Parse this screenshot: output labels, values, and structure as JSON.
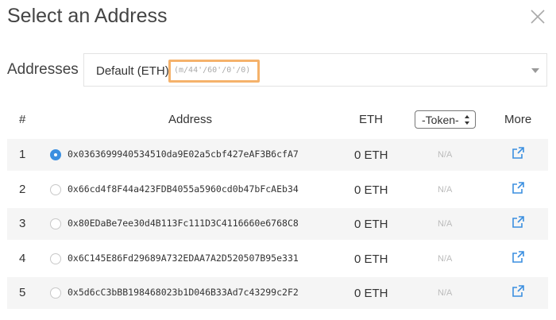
{
  "dialog": {
    "title": "Select an Address"
  },
  "addresses": {
    "label": "Addresses",
    "selected": "Default (ETH)",
    "path": "(m/44'/60'/0'/0)"
  },
  "table": {
    "headers": {
      "num": "#",
      "address": "Address",
      "eth": "ETH",
      "token": "-Token-",
      "more": "More"
    },
    "rows": [
      {
        "num": "1",
        "address": "0x0363699940534510da9E02a5cbf427eAF3B6cfA7",
        "eth": "0 ETH",
        "token": "N/A",
        "selected": true
      },
      {
        "num": "2",
        "address": "0x66cd4f8F44a423FDB4055a5960cd0b47bFcAEb34",
        "eth": "0 ETH",
        "token": "N/A",
        "selected": false
      },
      {
        "num": "3",
        "address": "0x80EDaBe7ee30d4B113Fc111D3C4116660e6768C8",
        "eth": "0 ETH",
        "token": "N/A",
        "selected": false
      },
      {
        "num": "4",
        "address": "0x6C145E86Fd29689A732EDAA7A2D520507B95e331",
        "eth": "0 ETH",
        "token": "N/A",
        "selected": false
      },
      {
        "num": "5",
        "address": "0x5d6cC3bBB198468023b1D046B33Ad7c43299c2F2",
        "eth": "0 ETH",
        "token": "N/A",
        "selected": false
      }
    ]
  },
  "colors": {
    "accent": "#3b8fe0",
    "path_highlight": "#f5b26b",
    "link_icon": "#3b8fe0"
  },
  "icons": {
    "close": "close-icon",
    "dropdown": "chevron-down-icon",
    "external": "external-link-icon"
  }
}
